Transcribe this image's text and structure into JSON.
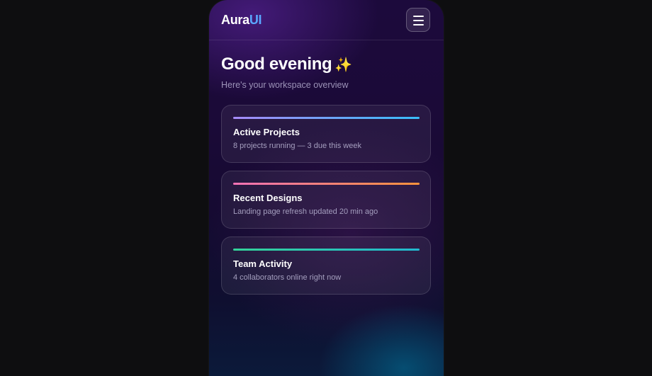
{
  "header": {
    "logo_main": "Aura",
    "logo_accent": "UI",
    "menu_icon": "hamburger-menu-icon"
  },
  "hero": {
    "greeting": "Good evening",
    "sparkle": "✨",
    "subtitle": "Here's your workspace overview"
  },
  "cards": [
    {
      "title": "Active Projects",
      "description": "8 projects running — 3 due this week",
      "accent_from": "#a78bfa",
      "accent_to": "#38bdf8"
    },
    {
      "title": "Recent Designs",
      "description": "Landing page refresh updated 20 min ago",
      "accent_from": "#f472b6",
      "accent_to": "#fb923c"
    },
    {
      "title": "Team Activity",
      "description": "4 collaborators online right now",
      "accent_from": "#34d399",
      "accent_to": "#22b8cf"
    }
  ],
  "colors": {
    "logo_accent": "#5aa7ff",
    "background_top": "#1c0a3c",
    "page_background": "#0e0e10"
  }
}
